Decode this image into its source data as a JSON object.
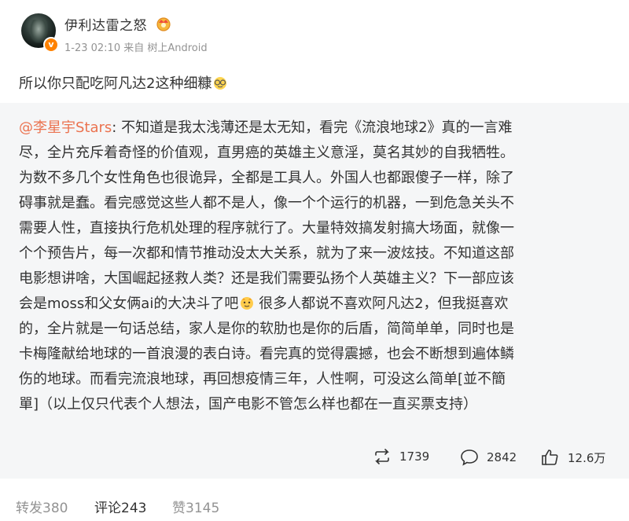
{
  "post": {
    "username": "伊利达雷之怒",
    "meta": "1-23 02:10 来自 树上Android",
    "text": "所以你只配吃阿凡达2这种细糠",
    "verified_symbol": "v"
  },
  "repost": {
    "mention": "@李星宇Stars",
    "body": ": 不知道是我太浅薄还是太无知，看完《流浪地球2》真的一言难\n尽，全片充斥着奇怪的价值观，直男癌的英雄主义意淫，莫名其妙的自我牺牲。\n为数不多几个女性角色也很诡异，全都是工具人。外国人也都跟傻子一样，除了\n碍事就是蠢。看完感觉这些人都不是人，像一个个运行的机器，一到危急关头不\n需要人性，直接执行危机处理的程序就行了。大量特效搞发射搞大场面，就像一\n个个预告片，每一次都和情节推动没太大关系，就为了来一波炫技。不知道这部\n电影想讲啥，大国崛起拯救人类？还是我们需要弘扬个人英雄主义？下一部应该\n会是moss和父女俩ai的大决斗了吧",
    "body_after_emoji": " 很多人都说不喜欢阿凡达2，但我挺喜欢\n的，全片就是一句话总结，家人是你的软肋也是你的后盾，简简单单，同时也是\n卡梅隆献给地球的一首浪漫的表白诗。看完真的觉得震撼，也会不断想到遍体鳞\n伤的地球。而看完流浪地球，再回想疫情三年，人性啊，可没这么简单[並不簡\n單]（以上仅只代表个人想法，国产电影不管怎么样也都在一直买票支持）",
    "reposts": "1739",
    "comments": "2842",
    "likes": "12.6万",
    "icons": {
      "repost": "repost-icon",
      "comment": "comment-icon",
      "like": "thumbs-up-icon"
    }
  },
  "footer": {
    "repost_label": "转发380",
    "comment_label": "评论243",
    "like_label": "赞3145"
  },
  "colors": {
    "mention": "#eb7350",
    "repost_bg": "#f5f6f7",
    "muted": "#939393"
  }
}
